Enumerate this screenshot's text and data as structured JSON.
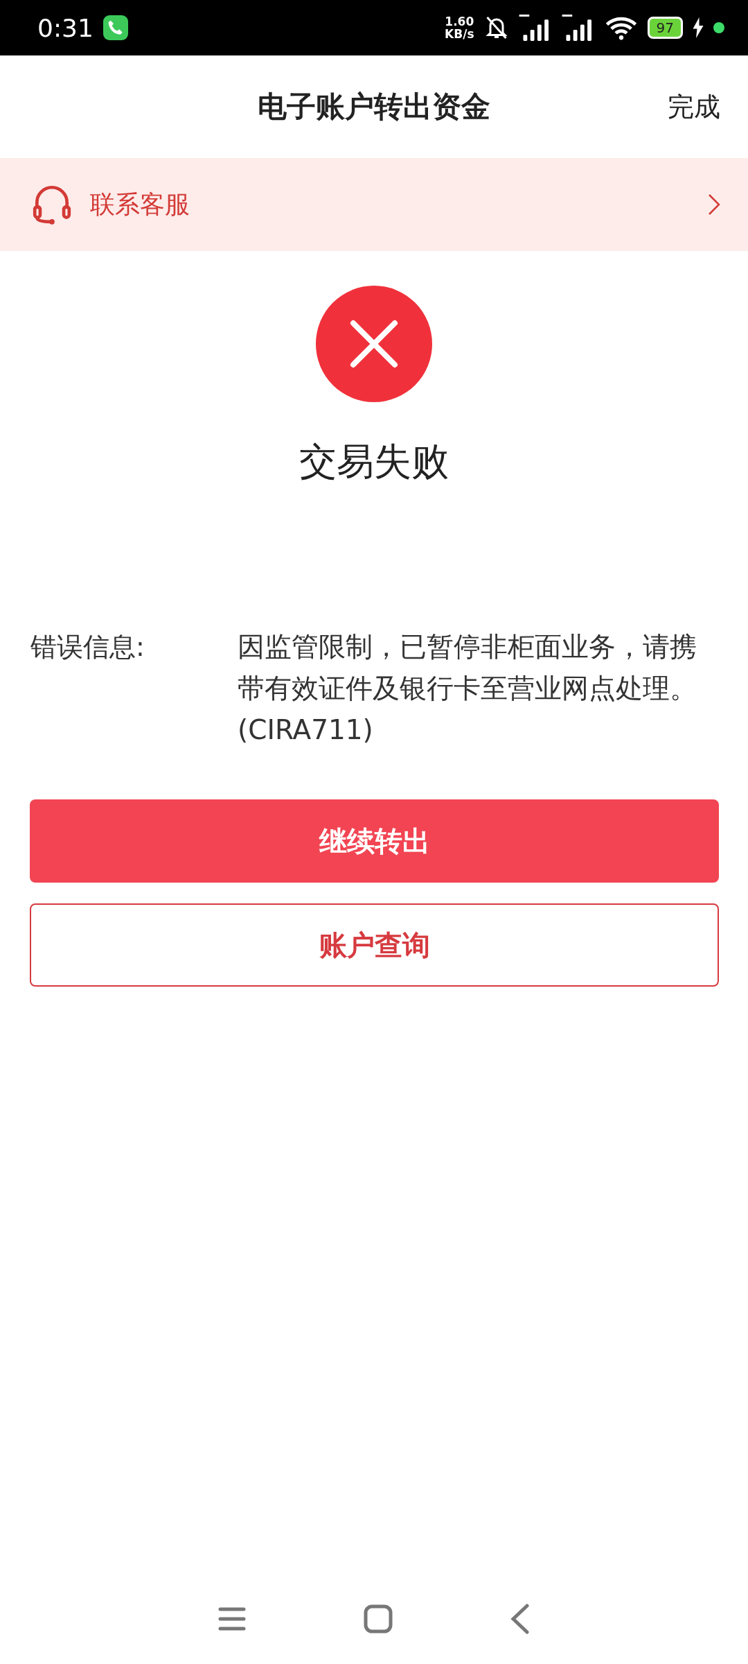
{
  "status_bar": {
    "time": "0:31",
    "speed_value": "1.60",
    "speed_unit": "KB/s",
    "battery": "97"
  },
  "header": {
    "title": "电子账户转出资金",
    "action": "完成"
  },
  "banner": {
    "label": "联系客服"
  },
  "result": {
    "failed": true,
    "title": "交易失败"
  },
  "error": {
    "label": "错误信息:",
    "message": "因监管限制，已暂停非柜面业务，请携带有效证件及银行卡至营业网点处理。(CIRA711)"
  },
  "buttons": [
    {
      "label": "继续转出",
      "kind": "primary"
    },
    {
      "label": "账户查询",
      "kind": "outline"
    }
  ]
}
